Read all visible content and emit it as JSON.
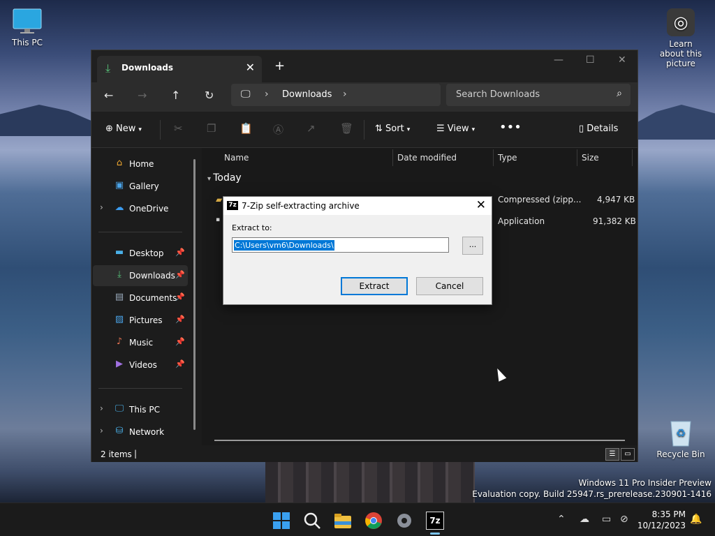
{
  "desktop": {
    "this_pc_label": "This PC",
    "recycle_bin_label": "Recycle Bin",
    "learn_label": "Learn about this picture"
  },
  "explorer": {
    "tab": {
      "title": "Downloads"
    },
    "address": {
      "crumb": "Downloads"
    },
    "search": {
      "placeholder": "Search Downloads"
    },
    "toolbar": {
      "new_label": "New",
      "sort_label": "Sort",
      "view_label": "View",
      "details_label": "Details"
    },
    "sidebar": {
      "items": [
        {
          "label": "Home",
          "icon": "home-icon"
        },
        {
          "label": "Gallery",
          "icon": "gallery-icon"
        },
        {
          "label": "OneDrive",
          "icon": "onedrive-icon"
        },
        {
          "label": "Desktop",
          "icon": "desktop-icon"
        },
        {
          "label": "Downloads",
          "icon": "download-icon"
        },
        {
          "label": "Documents",
          "icon": "documents-icon"
        },
        {
          "label": "Pictures",
          "icon": "pictures-icon"
        },
        {
          "label": "Music",
          "icon": "music-icon"
        },
        {
          "label": "Videos",
          "icon": "videos-icon"
        },
        {
          "label": "This PC",
          "icon": "pc-icon"
        },
        {
          "label": "Network",
          "icon": "network-icon"
        }
      ]
    },
    "columns": {
      "name": "Name",
      "date": "Date modified",
      "type": "Type",
      "size": "Size"
    },
    "group_label": "Today",
    "files": [
      {
        "type": "Compressed (zipp...",
        "size": "4,947 KB"
      },
      {
        "type": "Application",
        "size": "91,382 KB"
      }
    ],
    "status": {
      "items": "2 items",
      "caret": "|"
    }
  },
  "dialog": {
    "title": "7-Zip self-extracting archive",
    "icon_text": "7z",
    "label": "Extract to:",
    "path": "C:\\Users\\vm6\\Downloads\\",
    "browse_label": "...",
    "extract_label": "Extract",
    "cancel_label": "Cancel"
  },
  "taskbar": {
    "time": "8:35 PM",
    "date": "10/12/2023",
    "zip_icon_text": "7z"
  },
  "watermark": {
    "line1": "Windows 11 Pro Insider Preview",
    "line2": "Evaluation copy. Build 25947.rs_prerelease.230901-1416"
  }
}
